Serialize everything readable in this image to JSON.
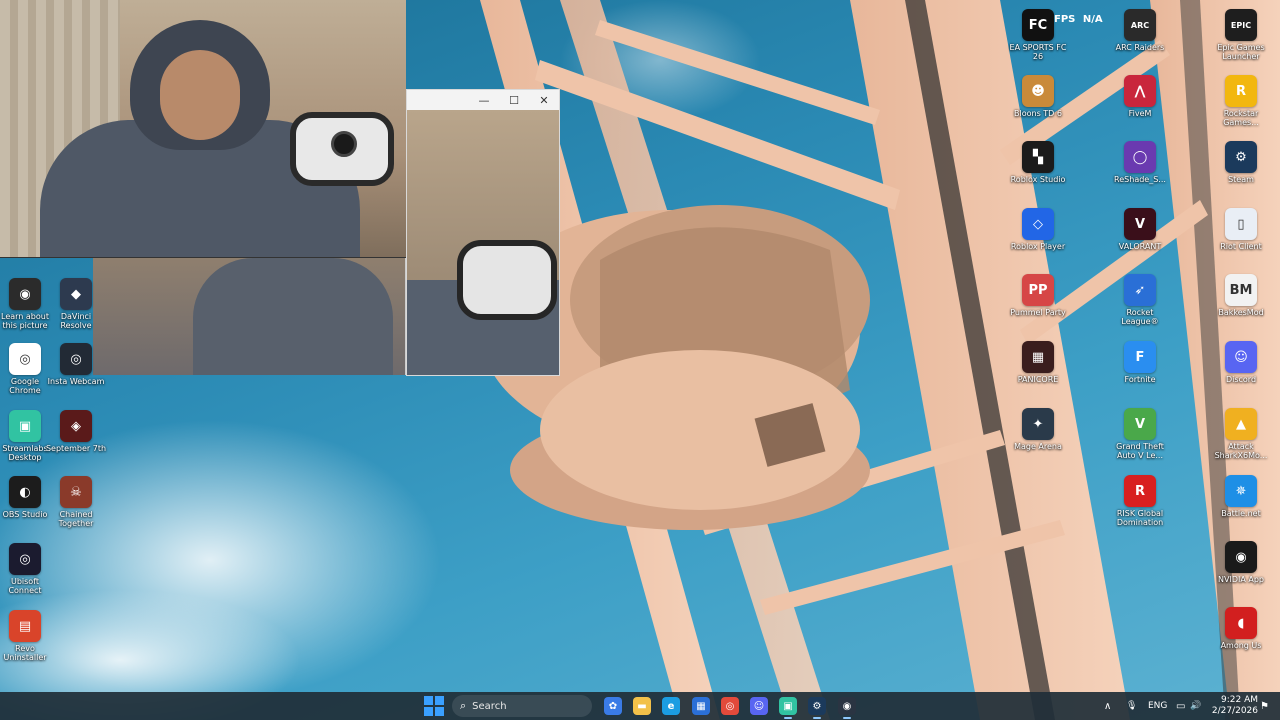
{
  "overlay": {
    "fps_label": "FPS",
    "fps_value": "N/A"
  },
  "camera_window": {
    "minimize": "—",
    "maximize": "☐",
    "close": "✕"
  },
  "desktop_left": [
    {
      "name": "learn-about-this-picture-shortcut",
      "label": "Learn about this picture",
      "icon": "camera-lens-icon",
      "color": "#2b2b2b",
      "glyph": "◉"
    },
    {
      "name": "davinci-resolve-shortcut",
      "label": "DaVinci Resolve",
      "icon": "davinci-resolve-icon",
      "color": "#2d3a4f",
      "glyph": "◆"
    },
    {
      "name": "google-chrome-shortcut",
      "label": "Google Chrome",
      "icon": "chrome-icon",
      "color": "#ffffff",
      "glyph": "◎"
    },
    {
      "name": "insta-webcam-shortcut",
      "label": "Insta Webcam",
      "icon": "webcam-icon",
      "color": "#222a35",
      "glyph": "◎"
    },
    {
      "name": "streamlabs-desktop-shortcut",
      "label": "Streamlabs Desktop",
      "icon": "streamlabs-icon",
      "color": "#31c3a2",
      "glyph": "▣"
    },
    {
      "name": "september-7th-shortcut",
      "label": "September 7th",
      "icon": "game-icon",
      "color": "#5a1a1a",
      "glyph": "◈"
    },
    {
      "name": "obs-studio-shortcut",
      "label": "OBS Studio",
      "icon": "obs-icon",
      "color": "#1c1c1c",
      "glyph": "◐"
    },
    {
      "name": "chained-together-shortcut",
      "label": "Chained Together",
      "icon": "game-icon",
      "color": "#8a3a2a",
      "glyph": "☠"
    },
    {
      "name": "ubisoft-connect-shortcut",
      "label": "Ubisoft Connect",
      "icon": "ubisoft-icon",
      "color": "#1b1b2f",
      "glyph": "◎"
    },
    {
      "name": "revo-uninstaller-shortcut",
      "label": "Revo Uninstaller",
      "icon": "uninstaller-icon",
      "color": "#d9442a",
      "glyph": "▤"
    }
  ],
  "desktop_right": [
    {
      "name": "ea-sports-fc-26-shortcut",
      "label": "EA SPORTS FC 26",
      "icon": "ea-fc-icon",
      "color": "#111111",
      "glyph": "FC"
    },
    {
      "name": "arc-raiders-shortcut",
      "label": "ARC Raiders",
      "icon": "arc-raiders-icon",
      "color": "#2a2a2a",
      "glyph": "ARC"
    },
    {
      "name": "epic-games-launcher-shortcut",
      "label": "Epic Games Launcher",
      "icon": "epic-games-icon",
      "color": "#1e1e1e",
      "glyph": "EPIC"
    },
    {
      "name": "bloons-td-6-shortcut",
      "label": "Bloons TD 6",
      "icon": "monkey-icon",
      "color": "#c98a3a",
      "glyph": "☻"
    },
    {
      "name": "fivem-shortcut",
      "label": "FiveM",
      "icon": "fivem-icon",
      "color": "#c9263c",
      "glyph": "⋀"
    },
    {
      "name": "rockstar-games-launcher-shortcut",
      "label": "Rockstar Games...",
      "icon": "rockstar-icon",
      "color": "#f2b70f",
      "glyph": "R"
    },
    {
      "name": "roblox-studio-shortcut",
      "label": "Roblox Studio",
      "icon": "roblox-studio-icon",
      "color": "#1b1b1b",
      "glyph": "▚"
    },
    {
      "name": "reshade-shortcut",
      "label": "ReShade_S...",
      "icon": "reshade-icon",
      "color": "#6a3ab0",
      "glyph": "◯"
    },
    {
      "name": "steam-shortcut",
      "label": "Steam",
      "icon": "steam-icon",
      "color": "#1b3a5c",
      "glyph": "⚙"
    },
    {
      "name": "roblox-player-shortcut",
      "label": "Roblox Player",
      "icon": "roblox-icon",
      "color": "#2266e6",
      "glyph": "◇"
    },
    {
      "name": "valorant-shortcut",
      "label": "VALORANT",
      "icon": "valorant-icon",
      "color": "#3a0f1a",
      "glyph": "V"
    },
    {
      "name": "riot-client-shortcut",
      "label": "Riot Client",
      "icon": "riot-icon",
      "color": "#e9eef5",
      "glyph": "▯"
    },
    {
      "name": "pummel-party-shortcut",
      "label": "Pummel Party",
      "icon": "pummel-party-icon",
      "color": "#d64646",
      "glyph": "PP"
    },
    {
      "name": "rocket-league-shortcut",
      "label": "Rocket League®",
      "icon": "rocket-league-icon",
      "color": "#2a6fd6",
      "glyph": "➶"
    },
    {
      "name": "bakkesmod-shortcut",
      "label": "BakkesMod",
      "icon": "bakkesmod-icon",
      "color": "#f2f2f2",
      "glyph": "BM"
    },
    {
      "name": "panicore-shortcut",
      "label": "PANICORE",
      "icon": "panicore-icon",
      "color": "#3a1d1d",
      "glyph": "▦"
    },
    {
      "name": "fortnite-shortcut",
      "label": "Fortnite",
      "icon": "fortnite-icon",
      "color": "#2a8ef0",
      "glyph": "F"
    },
    {
      "name": "discord-shortcut",
      "label": "Discord",
      "icon": "discord-icon",
      "color": "#5865f2",
      "glyph": "☺"
    },
    {
      "name": "mage-arena-shortcut",
      "label": "Mage Arena",
      "icon": "mage-arena-icon",
      "color": "#2a3a4a",
      "glyph": "✦"
    },
    {
      "name": "gta-v-shortcut",
      "label": "Grand Theft Auto V Le...",
      "icon": "gta-icon",
      "color": "#4aa84a",
      "glyph": "V"
    },
    {
      "name": "attack-shark-shortcut",
      "label": "Attack SharkX6Mo...",
      "icon": "shark-icon",
      "color": "#f0b020",
      "glyph": "▲"
    },
    {
      "name": "risk-shortcut",
      "label": "RISK Global Domination",
      "icon": "risk-icon",
      "color": "#d82020",
      "glyph": "R"
    },
    {
      "name": "battle-net-shortcut",
      "label": "Battle.net",
      "icon": "battle-net-icon",
      "color": "#1e8fe6",
      "glyph": "✵"
    },
    {
      "name": "nvidia-app-shortcut",
      "label": "NVIDIA App",
      "icon": "nvidia-icon",
      "color": "#1a1a1a",
      "glyph": "◉"
    },
    {
      "name": "among-us-shortcut",
      "label": "Among Us",
      "icon": "among-us-icon",
      "color": "#d21f1f",
      "glyph": "◖"
    }
  ],
  "taskbar": {
    "search_placeholder": "Search",
    "apps": [
      {
        "name": "copilot-taskbar-button",
        "icon": "copilot-icon",
        "color": "#3a7be6",
        "glyph": "✿"
      },
      {
        "name": "file-explorer-taskbar-button",
        "icon": "folder-icon",
        "color": "#f2c14a",
        "glyph": "▬"
      },
      {
        "name": "edge-taskbar-button",
        "icon": "edge-icon",
        "color": "#1b9de2",
        "glyph": "e"
      },
      {
        "name": "chrome-taskbar-button",
        "icon": "chrome-icon",
        "color": "#e24a3b",
        "glyph": "◎"
      },
      {
        "name": "microsoft-store-taskbar-button",
        "icon": "store-icon",
        "color": "#2b6fd6",
        "glyph": "▦"
      },
      {
        "name": "discord-taskbar-button",
        "icon": "discord-icon",
        "color": "#5865f2",
        "glyph": "☺"
      },
      {
        "name": "streamlabs-taskbar-button",
        "icon": "streamlabs-icon",
        "color": "#31c3a2",
        "glyph": "▣"
      },
      {
        "name": "steam-taskbar-button",
        "icon": "steam-icon",
        "color": "#1b3a5c",
        "glyph": "⚙"
      },
      {
        "name": "webcam-taskbar-button",
        "icon": "webcam-icon",
        "color": "#2a3442",
        "glyph": "◉"
      }
    ],
    "tray": {
      "chevron": "∧",
      "mic": "🎙",
      "language": "ENG",
      "network": "▭",
      "volume": "🔊",
      "battery": "▮",
      "time": "9:22 AM",
      "date": "2/27/2026",
      "notification": "⚑"
    }
  }
}
